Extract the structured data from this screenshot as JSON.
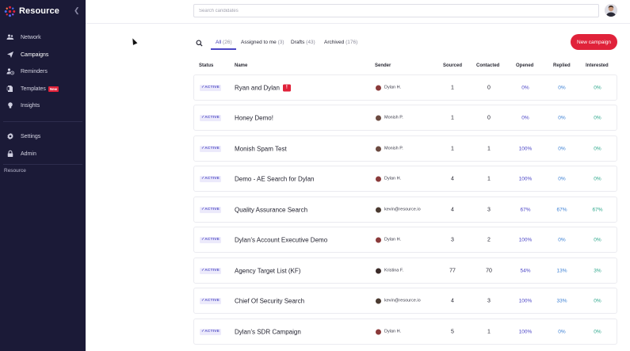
{
  "brand": {
    "name": "Resource"
  },
  "sidebar": {
    "items": [
      {
        "label": "Network",
        "icon": "people-icon"
      },
      {
        "label": "Campaigns",
        "icon": "paper-plane-icon"
      },
      {
        "label": "Reminders",
        "icon": "user-clock-icon"
      },
      {
        "label": "Templates",
        "icon": "document-icon",
        "badge": "New"
      },
      {
        "label": "Insights",
        "icon": "lightbulb-icon"
      },
      {
        "label": "Settings",
        "icon": "gear-icon"
      },
      {
        "label": "Admin",
        "icon": "lock-icon"
      }
    ],
    "org_label": "Resource"
  },
  "search": {
    "placeholder": "Search candidates"
  },
  "tabs": [
    {
      "label": "All",
      "count": "(26)"
    },
    {
      "label": "Assigned to me",
      "count": "(3)"
    },
    {
      "label": "Drafts",
      "count": "(43)"
    },
    {
      "label": "Archived",
      "count": "(176)"
    }
  ],
  "new_campaign_label": "New campaign",
  "table": {
    "headers": {
      "status": "Status",
      "name": "Name",
      "sender": "Sender",
      "sourced": "Sourced",
      "contacted": "Contacted",
      "opened": "Opened",
      "replied": "Replied",
      "interested": "Interested"
    },
    "rows": [
      {
        "status": "ACTIVE",
        "name": "Ryan and Dylan",
        "alert": "!",
        "sender": "Dylan H.",
        "sourced": "1",
        "contacted": "0",
        "opened": "0%",
        "replied": "0%",
        "interested": "0%"
      },
      {
        "status": "ACTIVE",
        "name": "Honey Demo!",
        "sender": "Monish P.",
        "sourced": "1",
        "contacted": "0",
        "opened": "0%",
        "replied": "0%",
        "interested": "0%"
      },
      {
        "status": "ACTIVE",
        "name": "Monish Spam Test",
        "sender": "Monish P.",
        "sourced": "1",
        "contacted": "1",
        "opened": "100%",
        "replied": "0%",
        "interested": "0%"
      },
      {
        "status": "ACTIVE",
        "name": "Demo - AE Search for Dylan",
        "sender": "Dylan H.",
        "sourced": "4",
        "contacted": "1",
        "opened": "100%",
        "replied": "0%",
        "interested": "0%"
      },
      {
        "status": "ACTIVE",
        "name": "Quality Assurance Search",
        "sender": "kevin@resource.io",
        "sourced": "4",
        "contacted": "3",
        "opened": "67%",
        "replied": "67%",
        "interested": "67%"
      },
      {
        "status": "ACTIVE",
        "name": "Dylan's Account Executive Demo",
        "sender": "Dylan H.",
        "sourced": "3",
        "contacted": "2",
        "opened": "100%",
        "replied": "0%",
        "interested": "0%"
      },
      {
        "status": "ACTIVE",
        "name": "Agency Target List (KF)",
        "sender": "Kristina F.",
        "sourced": "77",
        "contacted": "70",
        "opened": "54%",
        "replied": "13%",
        "interested": "3%"
      },
      {
        "status": "ACTIVE",
        "name": "Chief Of Security Search",
        "sender": "kevin@resource.io",
        "sourced": "4",
        "contacted": "3",
        "opened": "100%",
        "replied": "33%",
        "interested": "0%"
      },
      {
        "status": "ACTIVE",
        "name": "Dylan's SDR Campaign",
        "sender": "Dylan H.",
        "sourced": "5",
        "contacted": "1",
        "opened": "100%",
        "replied": "0%",
        "interested": "0%"
      }
    ]
  },
  "colors": {
    "sidebar_bg": "#1b1a37",
    "accent": "#e0223a",
    "active_tab": "#4b47c4"
  }
}
